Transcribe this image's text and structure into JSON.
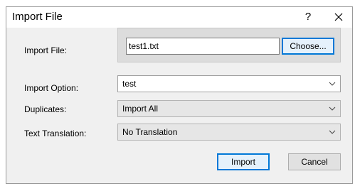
{
  "window": {
    "title": "Import File",
    "help_label": "?"
  },
  "import_file": {
    "label": "Import File:",
    "value": "test1.txt",
    "choose_label": "Choose..."
  },
  "import_option": {
    "label": "Import Option:",
    "selected": "test"
  },
  "duplicates": {
    "label": "Duplicates:",
    "selected": "Import All"
  },
  "text_translation": {
    "label": "Text Translation:",
    "selected": "No Translation"
  },
  "actions": {
    "import_label": "Import",
    "cancel_label": "Cancel"
  }
}
